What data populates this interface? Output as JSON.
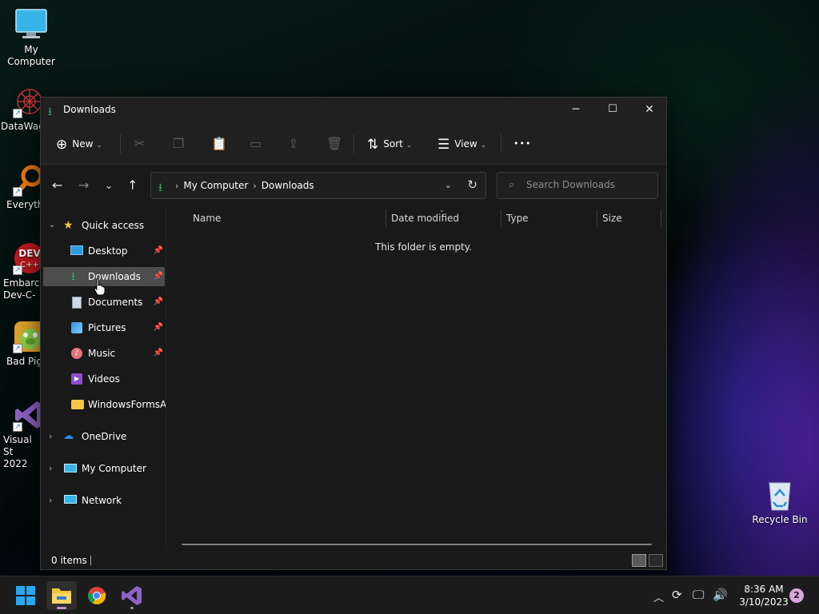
{
  "desktop": {
    "icons": [
      {
        "label": "My Computer",
        "name": "my-computer"
      },
      {
        "label": "DataWag",
        "name": "datawag"
      },
      {
        "label": "Everyth",
        "name": "everything"
      },
      {
        "label": "Embarca Dev-C-",
        "name": "dev-cpp"
      },
      {
        "label": "Bad Pig",
        "name": "bad-piggies"
      },
      {
        "label": "Visual St 2022",
        "name": "visual-studio"
      },
      {
        "label": "Recycle Bin",
        "name": "recycle-bin"
      }
    ]
  },
  "window": {
    "title": "Downloads",
    "caption": {
      "minimize": "─",
      "maximize": "☐",
      "close": "✕"
    }
  },
  "toolbar": {
    "new_label": "New",
    "sort_label": "Sort",
    "view_label": "View",
    "more_label": "•••"
  },
  "address": {
    "crumbs": [
      "My Computer",
      "Downloads"
    ],
    "search_placeholder": "Search Downloads"
  },
  "sidebar": {
    "quick_access": "Quick access",
    "items": [
      {
        "label": "Desktop",
        "icon": "desktop-icon",
        "pinned": true
      },
      {
        "label": "Downloads",
        "icon": "downloads-icon",
        "pinned": true,
        "selected": true
      },
      {
        "label": "Documents",
        "icon": "documents-icon",
        "pinned": true
      },
      {
        "label": "Pictures",
        "icon": "pictures-icon",
        "pinned": true
      },
      {
        "label": "Music",
        "icon": "music-icon",
        "pinned": true
      },
      {
        "label": "Videos",
        "icon": "videos-icon",
        "pinned": false
      },
      {
        "label": "WindowsFormsAp",
        "icon": "folder-icon",
        "pinned": false
      }
    ],
    "roots": [
      {
        "label": "OneDrive",
        "icon": "onedrive-icon"
      },
      {
        "label": "My Computer",
        "icon": "my-computer-icon"
      },
      {
        "label": "Network",
        "icon": "network-icon"
      }
    ]
  },
  "columns": [
    "Name",
    "Date modified",
    "Type",
    "Size"
  ],
  "empty_message": "This folder is empty.",
  "status": {
    "item_count": "0 items"
  },
  "taskbar": {
    "clock_time": "8:36 AM",
    "clock_date": "3/10/2023",
    "notification_count": "2"
  },
  "colors": {
    "accent_green": "#1fb36b",
    "selection": "#4d4d4d",
    "window_bg": "#191919",
    "taskbar_bg": "#1c1c1c"
  }
}
